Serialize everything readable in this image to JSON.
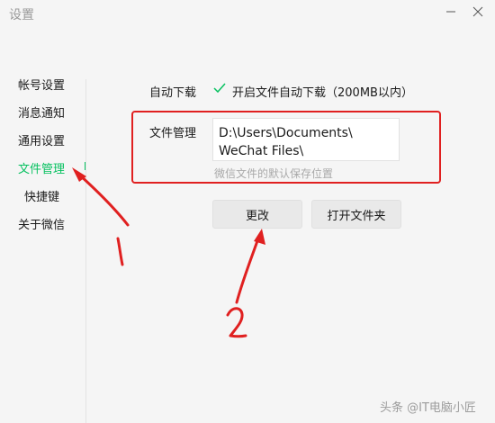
{
  "window": {
    "title": "设置",
    "minimize_icon": "minimize-icon",
    "close_icon": "close-icon"
  },
  "sidebar": {
    "items": [
      {
        "label": "帐号设置"
      },
      {
        "label": "消息通知"
      },
      {
        "label": "通用设置"
      },
      {
        "label": "文件管理",
        "active": true
      },
      {
        "label": "快捷键"
      },
      {
        "label": "关于微信"
      }
    ],
    "active_color": "#07c160"
  },
  "download": {
    "label": "自动下载",
    "checkbox_checked": true,
    "checkbox_text": "开启文件自动下载（200MB以内）"
  },
  "file_management": {
    "label": "文件管理",
    "path_line1": "D:\\Users\\Documents\\",
    "path_line2": "WeChat Files\\",
    "hint": "微信文件的默认保存位置"
  },
  "buttons": {
    "change": "更改",
    "open_folder": "打开文件夹"
  },
  "annotations": {
    "mark_1": "1",
    "mark_2": "2",
    "color": "#e02020"
  },
  "watermark": "头条 @IT电脑小匠"
}
